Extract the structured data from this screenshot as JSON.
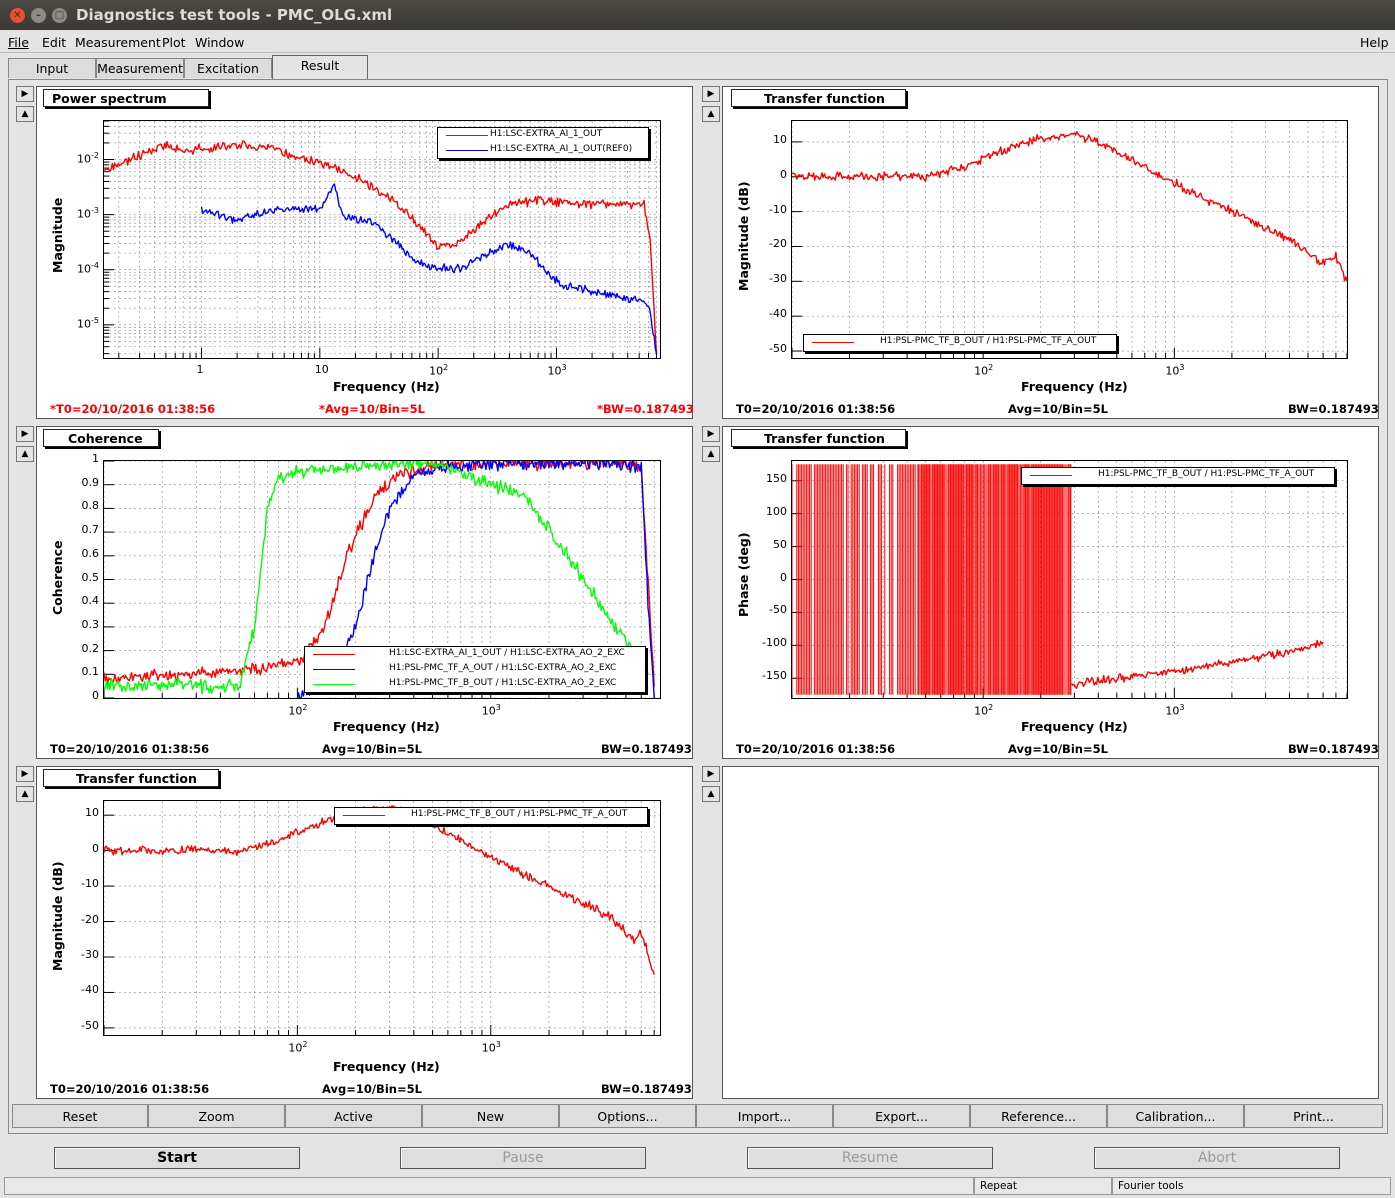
{
  "window": {
    "title": "Diagnostics test tools - PMC_OLG.xml"
  },
  "menu": {
    "file": "File",
    "edit": "Edit",
    "measurement": "Measurement",
    "plot": "Plot",
    "window": "Window",
    "help": "Help"
  },
  "tabs": [
    "Input",
    "Measurement",
    "Excitation",
    "Result"
  ],
  "active_tab": "Result",
  "colors": {
    "red": "#ff0000",
    "blue": "#0000ff",
    "green": "#00ff00",
    "info_red": "#ff0000"
  },
  "panels": {
    "p1": {
      "title": "Power spectrum",
      "info": {
        "t0": "*T0=20/10/2016 01:38:56",
        "avg": "*Avg=10/Bin=5L",
        "bw": "*BW=0.187493"
      },
      "legend": [
        "H1:LSC-EXTRA_AI_1_OUT",
        "H1:LSC-EXTRA_AI_1_OUT(REF0)"
      ]
    },
    "p2": {
      "title": "Transfer function",
      "info": {
        "t0": "T0=20/10/2016 01:38:56",
        "avg": "Avg=10/Bin=5L",
        "bw": "BW=0.187493"
      },
      "legend": [
        "H1:PSL-PMC_TF_B_OUT / H1:PSL-PMC_TF_A_OUT"
      ]
    },
    "p3": {
      "title": "Coherence",
      "info": {
        "t0": "T0=20/10/2016 01:38:56",
        "avg": "Avg=10/Bin=5L",
        "bw": "BW=0.187493"
      },
      "legend": [
        "H1:LSC-EXTRA_AI_1_OUT / H1:LSC-EXTRA_AO_2_EXC",
        "H1:PSL-PMC_TF_A_OUT / H1:LSC-EXTRA_AO_2_EXC",
        "H1:PSL-PMC_TF_B_OUT / H1:LSC-EXTRA_AO_2_EXC"
      ]
    },
    "p4": {
      "title": "Transfer function",
      "info": {
        "t0": "T0=20/10/2016 01:38:56",
        "avg": "Avg=10/Bin=5L",
        "bw": "BW=0.187493"
      },
      "legend": [
        "H1:PSL-PMC_TF_B_OUT / H1:PSL-PMC_TF_A_OUT"
      ]
    },
    "p5": {
      "title": "Transfer function",
      "info": {
        "t0": "T0=20/10/2016 01:38:56",
        "avg": "Avg=10/Bin=5L",
        "bw": "BW=0.187493"
      },
      "legend": [
        "H1:PSL-PMC_TF_B_OUT / H1:PSL-PMC_TF_A_OUT"
      ]
    }
  },
  "chart_data": [
    {
      "id": "p1",
      "type": "line",
      "xscale": "log",
      "yscale": "log",
      "xlabel": "Frequency (Hz)",
      "ylabel": "Magnitude",
      "xlim": [
        0.15,
        7500
      ],
      "ylim": [
        2.5e-06,
        0.05
      ],
      "xticks": [
        {
          "v": 1,
          "t": "1"
        },
        {
          "v": 10,
          "t": "10"
        },
        {
          "v": 100,
          "t": "10",
          "e": "2"
        },
        {
          "v": 1000,
          "t": "10",
          "e": "3"
        }
      ],
      "yticks": [
        {
          "v": 0.01,
          "t": "10",
          "e": "-2"
        },
        {
          "v": 0.001,
          "t": "10",
          "e": "-3"
        },
        {
          "v": 0.0001,
          "t": "10",
          "e": "-4"
        },
        {
          "v": 1e-05,
          "t": "10",
          "e": "-5"
        }
      ],
      "series": [
        {
          "name": "H1:LSC-EXTRA_AI_1_OUT",
          "color": "#ff0000",
          "x": [
            0.15,
            0.3,
            0.5,
            0.7,
            1,
            2,
            4,
            7,
            10,
            20,
            40,
            70,
            100,
            150,
            250,
            400,
            700,
            1000,
            2000,
            4000,
            5500,
            6200,
            7000
          ],
          "y": [
            0.006,
            0.012,
            0.019,
            0.013,
            0.016,
            0.018,
            0.016,
            0.01,
            0.009,
            0.005,
            0.002,
            0.0006,
            0.00025,
            0.0003,
            0.0008,
            0.0016,
            0.0018,
            0.0017,
            0.0016,
            0.0015,
            0.0015,
            0.0003,
            3e-06
          ]
        },
        {
          "name": "H1:LSC-EXTRA_AI_1_OUT(REF0)",
          "color": "#0000ff",
          "x": [
            1,
            2,
            4,
            8,
            10,
            13,
            16,
            25,
            40,
            60,
            100,
            150,
            250,
            400,
            600,
            1000,
            2000,
            4000,
            6000,
            7000
          ],
          "y": [
            0.0012,
            0.0008,
            0.0012,
            0.0013,
            0.0012,
            0.0035,
            0.0009,
            0.0008,
            0.0004,
            0.00015,
            0.0001,
            0.00011,
            0.00018,
            0.0003,
            0.0002,
            6e-05,
            4e-05,
            3e-05,
            2.5e-05,
            3e-06
          ]
        }
      ]
    },
    {
      "id": "p2",
      "type": "line",
      "xscale": "log",
      "yscale": "linear",
      "xlabel": "Frequency (Hz)",
      "ylabel": "Magnitude (dB)",
      "xlim": [
        10,
        8000
      ],
      "ylim": [
        -52,
        16
      ],
      "xticks": [
        {
          "v": 100,
          "t": "10",
          "e": "2"
        },
        {
          "v": 1000,
          "t": "10",
          "e": "3"
        }
      ],
      "yticks": [
        {
          "v": 10,
          "t": "10"
        },
        {
          "v": 0,
          "t": "0"
        },
        {
          "v": -10,
          "t": "-10"
        },
        {
          "v": -20,
          "t": "-20"
        },
        {
          "v": -30,
          "t": "-30"
        },
        {
          "v": -40,
          "t": "-40"
        },
        {
          "v": -50,
          "t": "-50"
        }
      ],
      "series": [
        {
          "name": "H1:PSL-PMC_TF_B_OUT / H1:PSL-PMC_TF_A_OUT",
          "color": "#ff0000",
          "x": [
            10,
            30,
            50,
            60,
            80,
            120,
            200,
            300,
            400,
            700,
            1000,
            2000,
            4000,
            6000,
            7000,
            8000
          ],
          "y": [
            0,
            0,
            0,
            1,
            3,
            7,
            11,
            12,
            10,
            3,
            -2,
            -10,
            -18,
            -25,
            -23,
            -30
          ]
        }
      ]
    },
    {
      "id": "p3",
      "type": "line",
      "xscale": "log",
      "yscale": "linear",
      "xlabel": "Frequency (Hz)",
      "ylabel": "Coherence",
      "xlim": [
        10,
        7500
      ],
      "ylim": [
        0,
        1
      ],
      "xticks": [
        {
          "v": 100,
          "t": "10",
          "e": "2"
        },
        {
          "v": 1000,
          "t": "10",
          "e": "3"
        }
      ],
      "yticks": [
        {
          "v": 1,
          "t": "1"
        },
        {
          "v": 0.9,
          "t": "0.9"
        },
        {
          "v": 0.8,
          "t": "0.8"
        },
        {
          "v": 0.7,
          "t": "0.7"
        },
        {
          "v": 0.6,
          "t": "0.6"
        },
        {
          "v": 0.5,
          "t": "0.5"
        },
        {
          "v": 0.4,
          "t": "0.4"
        },
        {
          "v": 0.3,
          "t": "0.3"
        },
        {
          "v": 0.2,
          "t": "0.2"
        },
        {
          "v": 0.1,
          "t": "0.1"
        },
        {
          "v": 0,
          "t": "0"
        }
      ],
      "series": [
        {
          "name": "H1:LSC-EXTRA_AI_1_OUT / H1:LSC-EXTRA_AO_2_EXC",
          "color": "#ff0000",
          "x": [
            10,
            30,
            60,
            100,
            140,
            180,
            250,
            350,
            500,
            1000,
            2000,
            4000,
            6000,
            7000
          ],
          "y": [
            0.08,
            0.1,
            0.12,
            0.15,
            0.3,
            0.6,
            0.85,
            0.95,
            0.98,
            0.99,
            0.99,
            0.99,
            0.98,
            0.05
          ]
        },
        {
          "name": "H1:PSL-PMC_TF_A_OUT / H1:LSC-EXTRA_AO_2_EXC",
          "color": "#0000ff",
          "x": [
            100,
            150,
            200,
            250,
            300,
            400,
            600,
            1000,
            2000,
            4000,
            6000,
            6500,
            7000
          ],
          "y": [
            0.0,
            0.1,
            0.3,
            0.6,
            0.8,
            0.94,
            0.98,
            0.99,
            0.99,
            0.99,
            0.98,
            0.4,
            0.0
          ]
        },
        {
          "name": "H1:PSL-PMC_TF_B_OUT / H1:LSC-EXTRA_AO_2_EXC",
          "color": "#00ff00",
          "x": [
            10,
            50,
            60,
            70,
            80,
            100,
            200,
            500,
            1000,
            1500,
            2500,
            4000,
            5500,
            6500
          ],
          "y": [
            0.05,
            0.05,
            0.3,
            0.8,
            0.93,
            0.96,
            0.98,
            0.99,
            0.9,
            0.85,
            0.6,
            0.35,
            0.2,
            0.1
          ]
        }
      ]
    },
    {
      "id": "p4",
      "type": "line",
      "xscale": "log",
      "yscale": "linear",
      "xlabel": "Frequency (Hz)",
      "ylabel": "Phase (deg)",
      "xlim": [
        10,
        8000
      ],
      "ylim": [
        -180,
        180
      ],
      "xticks": [
        {
          "v": 100,
          "t": "10",
          "e": "2"
        },
        {
          "v": 1000,
          "t": "10",
          "e": "3"
        }
      ],
      "yticks": [
        {
          "v": 150,
          "t": "150"
        },
        {
          "v": 100,
          "t": "100"
        },
        {
          "v": 50,
          "t": "50"
        },
        {
          "v": 0,
          "t": "0"
        },
        {
          "v": -50,
          "t": "-50"
        },
        {
          "v": -100,
          "t": "-100"
        },
        {
          "v": -150,
          "t": "-150"
        }
      ],
      "series": [
        {
          "name": "H1:PSL-PMC_TF_B_OUT / H1:PSL-PMC_TF_A_OUT",
          "color": "#ff0000",
          "wrapped_until": 290,
          "x": [
            290,
            500,
            1000,
            2000,
            4000,
            5500,
            6000
          ],
          "y": [
            -160,
            -150,
            -140,
            -125,
            -110,
            -100,
            -95
          ]
        }
      ]
    },
    {
      "id": "p5",
      "type": "line",
      "xscale": "log",
      "yscale": "linear",
      "xlabel": "Frequency (Hz)",
      "ylabel": "Magnitude (dB)",
      "xlim": [
        10,
        7500
      ],
      "ylim": [
        -52,
        14
      ],
      "xticks": [
        {
          "v": 100,
          "t": "10",
          "e": "2"
        },
        {
          "v": 1000,
          "t": "10",
          "e": "3"
        }
      ],
      "yticks": [
        {
          "v": 10,
          "t": "10"
        },
        {
          "v": 0,
          "t": "0"
        },
        {
          "v": -10,
          "t": "-10"
        },
        {
          "v": -20,
          "t": "-20"
        },
        {
          "v": -30,
          "t": "-30"
        },
        {
          "v": -40,
          "t": "-40"
        },
        {
          "v": -50,
          "t": "-50"
        }
      ],
      "series": [
        {
          "name": "H1:PSL-PMC_TF_B_OUT / H1:PSL-PMC_TF_A_OUT",
          "color": "#ff0000",
          "x": [
            10,
            30,
            50,
            60,
            80,
            120,
            200,
            300,
            400,
            700,
            1000,
            2000,
            4000,
            5500,
            6000,
            7000
          ],
          "y": [
            0,
            0,
            0,
            1,
            3,
            7,
            11,
            12,
            10,
            3,
            -2,
            -10,
            -18,
            -25,
            -23,
            -35
          ]
        }
      ]
    }
  ],
  "toolbar": [
    "Reset",
    "Zoom",
    "Active",
    "New",
    "Options...",
    "Import...",
    "Export...",
    "Reference...",
    "Calibration...",
    "Print..."
  ],
  "actions": {
    "start": "Start",
    "pause": "Pause",
    "resume": "Resume",
    "abort": "Abort"
  },
  "status": {
    "repeat": "Repeat",
    "fourier": "Fourier tools"
  }
}
